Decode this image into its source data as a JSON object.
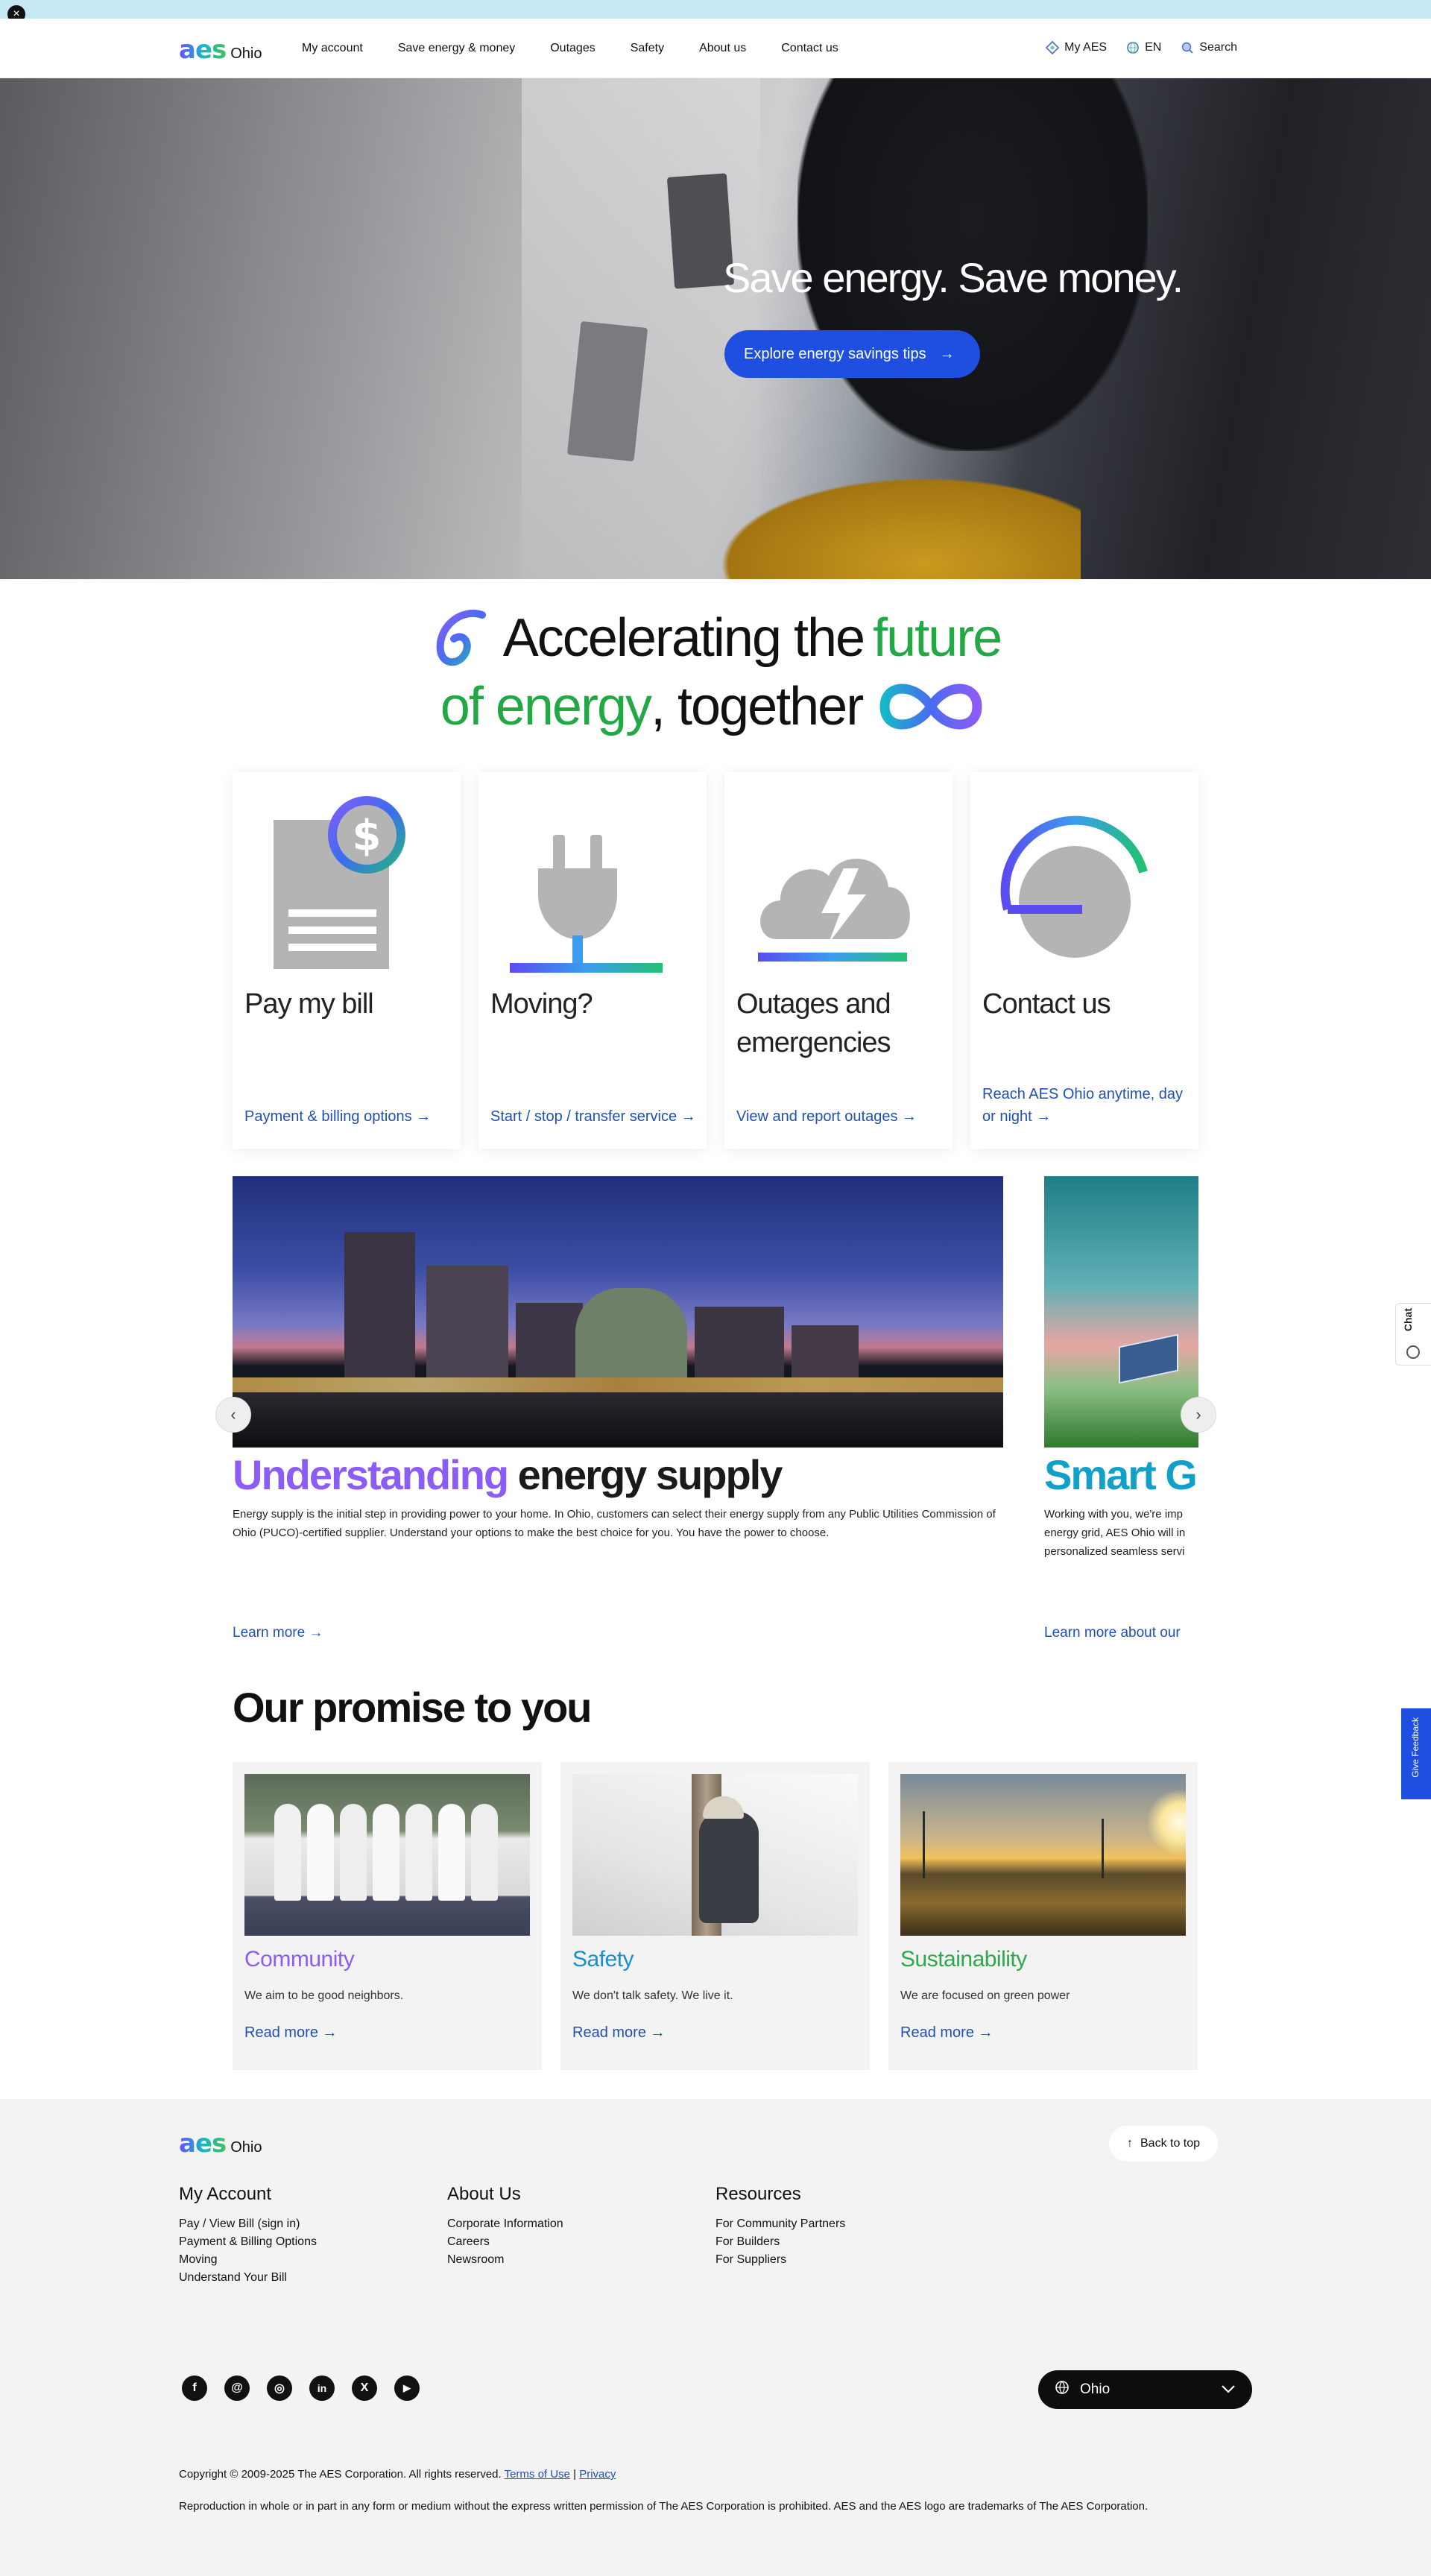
{
  "topbar": {
    "close_icon": "close-icon"
  },
  "brand": {
    "logo_mark": "aes",
    "logo_text": "Ohio"
  },
  "nav": {
    "items": [
      "My account",
      "Save energy & money",
      "Outages",
      "Safety",
      "About us",
      "Contact us"
    ]
  },
  "utility": {
    "my_aes": "My AES",
    "language": "EN",
    "search": "Search"
  },
  "hero": {
    "title": "Save energy. Save money.",
    "button_label": "Explore energy savings tips"
  },
  "tagline": {
    "part1": "Accelerating the",
    "part2": "future",
    "part3": "of energy",
    "part4": ", together"
  },
  "cards": [
    {
      "title": "Pay my bill",
      "link": "Payment & billing options"
    },
    {
      "title": "Moving?",
      "link": "Start / stop / transfer service"
    },
    {
      "title": "Outages and emergencies",
      "link": "View and report outages"
    },
    {
      "title": "Contact us",
      "link": "Reach AES Ohio anytime, day or night"
    }
  ],
  "carousel": {
    "slide1": {
      "title_accent": "Understanding",
      "title_rest": " energy supply",
      "desc": "Energy supply is the initial step in providing power to your home. In Ohio, customers can select their energy supply from any Public Utilities Commission of Ohio (PUCO)-certified supplier. Understand your options to make the best choice for you. You have the power to choose.",
      "link": "Learn more"
    },
    "slide2": {
      "title": "Smart Gri",
      "desc_line1": "Working with you, we're imp",
      "desc_line2": "energy grid, AES Ohio will in",
      "desc_line3": "personalized seamless servi",
      "link": "Learn more about our"
    },
    "prev": "‹",
    "next": "›"
  },
  "chat": {
    "label": "Chat"
  },
  "feedback": {
    "label": "Give Feedback"
  },
  "promise": {
    "title": "Our promise to you",
    "cards": [
      {
        "title": "Community",
        "desc": "We aim to be good neighbors.",
        "link": "Read more",
        "color": "#8b5cf6"
      },
      {
        "title": "Safety",
        "desc": "We don't talk safety. We live it.",
        "link": "Read more",
        "color": "#1a8fc9"
      },
      {
        "title": "Sustainability",
        "desc": "We are focused on green power",
        "link": "Read more",
        "color": "#2da84b"
      }
    ]
  },
  "footer": {
    "back_to_top": "Back to top",
    "columns": [
      {
        "heading": "My Account",
        "items": [
          "Pay / View Bill (sign in)",
          "Payment & Billing Options",
          "Moving",
          "Understand Your Bill"
        ]
      },
      {
        "heading": "About Us",
        "items": [
          "Corporate Information",
          "Careers",
          "Newsroom"
        ]
      },
      {
        "heading": "Resources",
        "items": [
          "For Community Partners",
          "For Builders",
          "For Suppliers"
        ]
      }
    ],
    "socials": [
      "facebook-icon",
      "threads-icon",
      "instagram-icon",
      "linkedin-icon",
      "x-icon",
      "youtube-icon"
    ],
    "region": "Ohio",
    "copyright": "Copyright © 2009-2025 The AES Corporation. All rights reserved.",
    "terms": "Terms of Use",
    "separator": "|",
    "privacy": "Privacy",
    "reproduction": "Reproduction in whole or in part in any form or medium without the express written permission of The AES Corporation is prohibited. AES and the AES logo are trademarks of The AES Corporation."
  },
  "colors": {
    "accent_blue": "#1f4fe0",
    "link_blue": "#1f4fb8",
    "green": "#22a845",
    "purple": "#8b5cf6",
    "teal": "#12a0c9"
  }
}
